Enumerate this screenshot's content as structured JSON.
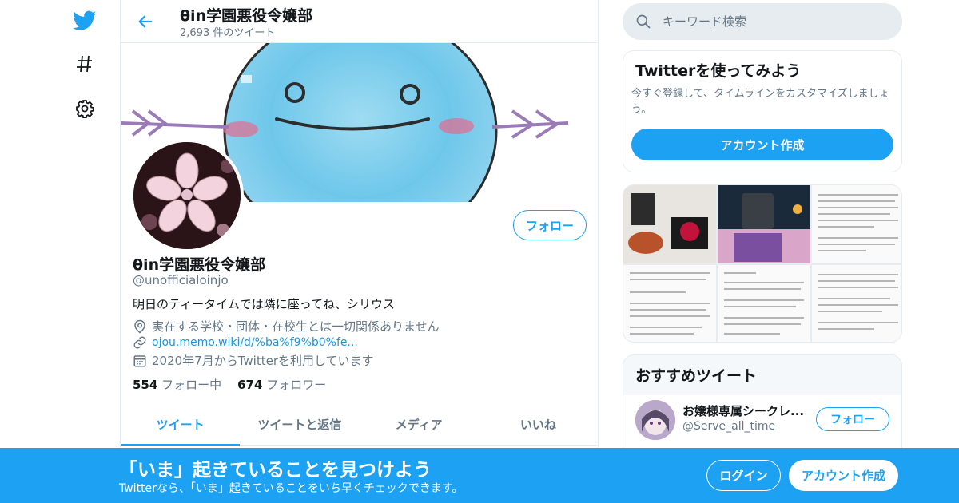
{
  "header": {
    "title": "θin学園悪役令嬢部",
    "tweet_count": "2,693 件のツイート"
  },
  "profile": {
    "name": "θin学園悪役令嬢部",
    "handle": "@unofficialoinjo",
    "bio": "明日のティータイムでは隣に座ってね、シリウス",
    "location": "実在する学校・団体・在校生とは一切関係ありません",
    "url": "ojou.memo.wiki/d/%ba%f9%b0%fe...",
    "joined": "2020年7月からTwitterを利用しています",
    "following_count": "554",
    "following_label": "フォロー中",
    "followers_count": "674",
    "followers_label": "フォロワー",
    "follow_label": "フォロー"
  },
  "tabs": [
    {
      "label": "ツイート"
    },
    {
      "label": "ツイートと返信"
    },
    {
      "label": "メディア"
    },
    {
      "label": "いいね"
    }
  ],
  "search": {
    "placeholder": "キーワード検索"
  },
  "signup_card": {
    "title": "Twitterを使ってみよう",
    "text": "今すぐ登録して、タイムラインをカスタマイズしましょう。",
    "button": "アカウント作成"
  },
  "recommend": {
    "title": "おすすめツイート",
    "name": "お嬢様専属シークレ...",
    "handle": "@Serve_all_time",
    "follow_label": "フォロー"
  },
  "bottom_bar": {
    "title": "「いま」起きていることを見つけよう",
    "subtitle": "Twitterなら、「いま」起きていることをいち早くチェックできます。",
    "login": "ログイン",
    "signup": "アカウント作成"
  },
  "colors": {
    "accent": "#1da1f2",
    "text": "#14171a",
    "secondary": "#657786"
  },
  "icons": [
    "twitter-bird-icon",
    "hashtag-icon",
    "gear-icon",
    "back-arrow-icon",
    "search-icon",
    "location-icon",
    "link-icon",
    "calendar-icon"
  ]
}
